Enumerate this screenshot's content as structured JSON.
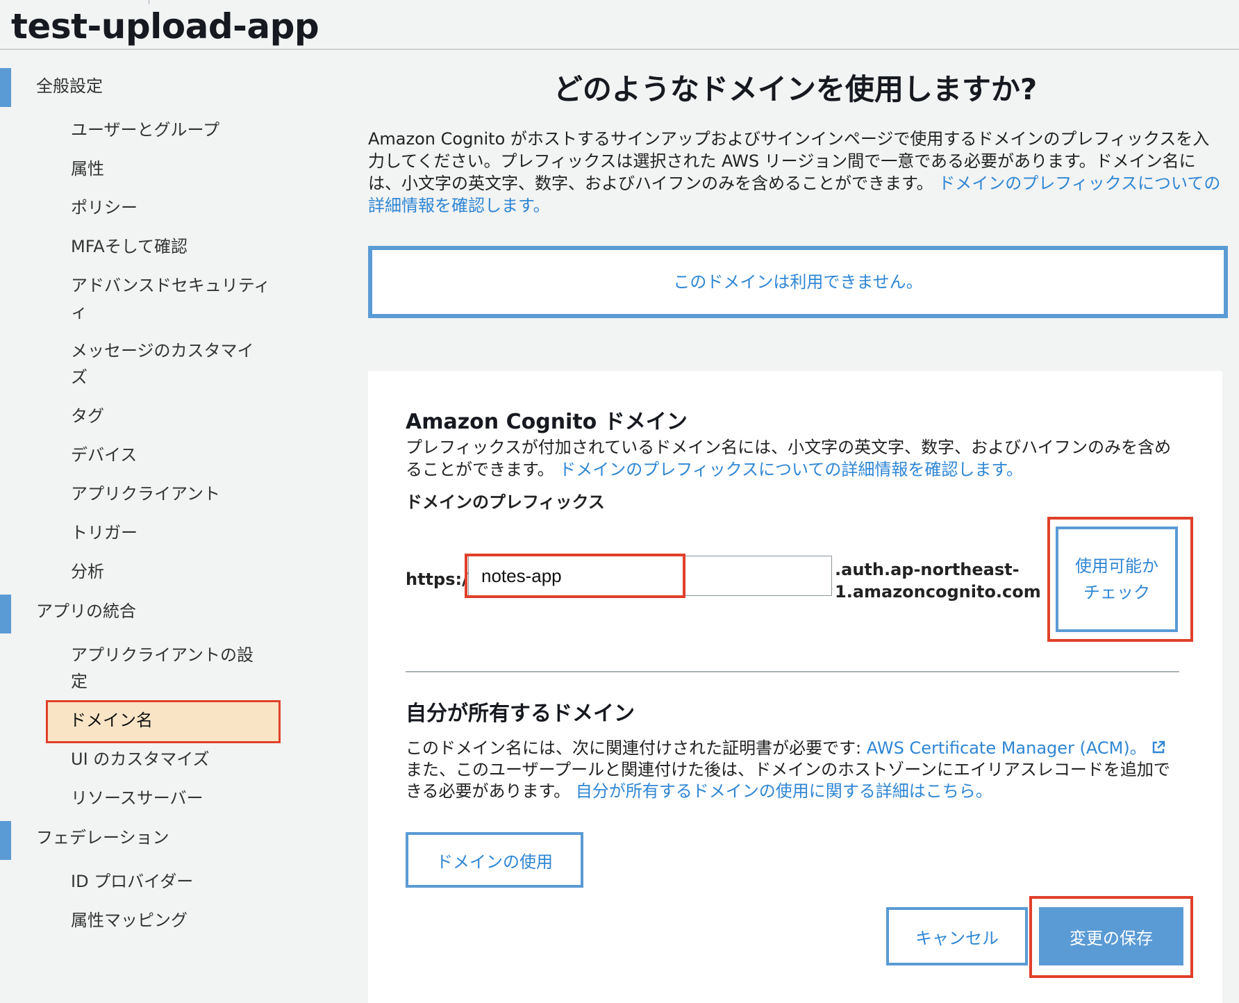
{
  "app": {
    "title": "test-upload-app"
  },
  "sidebar": {
    "sections": [
      {
        "label": "全般設定"
      },
      {
        "label": "アプリの統合"
      },
      {
        "label": "フェデレーション"
      }
    ],
    "general_items": [
      "ユーザーとグループ",
      "属性",
      "ポリシー",
      "MFAそして確認",
      "アドバンスドセキュリティ",
      "ィ",
      "メッセージのカスタマイ",
      "ズ",
      "タグ",
      "デバイス",
      "アプリクライアント",
      "トリガー",
      "分析"
    ],
    "integration_items": [
      "アプリクライアントの設",
      "定",
      "ドメイン名",
      "UI のカスタマイズ",
      "リソースサーバー"
    ],
    "federation_items": [
      "ID プロバイダー",
      "属性マッピング"
    ]
  },
  "main": {
    "heading": "どのようなドメインを使用しますか?",
    "intro_text": "Amazon Cognito がホストするサインアップおよびサインインページで使用するドメインのプレフィックスを入力してください。プレフィックスは選択された AWS リージョン間で一意である必要があります。ドメイン名には、小文字の英文字、数字、およびハイフンのみを含めることができます。",
    "intro_link": "ドメインのプレフィックスについての詳細情報を確認します。",
    "alert": "このドメインは利用できません。"
  },
  "cognito_domain": {
    "title": "Amazon Cognito ドメイン",
    "desc": "プレフィックスが付加されているドメイン名には、小文字の英文字、数字、およびハイフンのみを含めることができます。",
    "desc_link": "ドメインのプレフィックスについての詳細情報を確認します。",
    "prefix_label": "ドメインのプレフィックス",
    "https": "https://",
    "prefix_value": "notes-app",
    "suffix_line1": ".auth.ap-northeast-",
    "suffix_line2": "1.amazoncognito.com",
    "check_button": "使用可能かチェック"
  },
  "own_domain": {
    "title": "自分が所有するドメイン",
    "desc1": "このドメイン名には、次に関連付けされた証明書が必要です:",
    "acm_link": "AWS Certificate Manager (ACM)。",
    "desc2": "また、このユーザープールと関連付けた後は、ドメインのホストゾーンにエイリアスレコードを追加できる必要があります。",
    "desc_link": "自分が所有するドメインの使用に関する詳細はこちら。",
    "use_button": "ドメインの使用"
  },
  "actions": {
    "cancel": "キャンセル",
    "save": "変更の保存"
  },
  "colors": {
    "accent": "#5a9bd5",
    "link": "#2f86d4",
    "highlight": "#e0402a",
    "active_bg": "#f9e5c6"
  }
}
